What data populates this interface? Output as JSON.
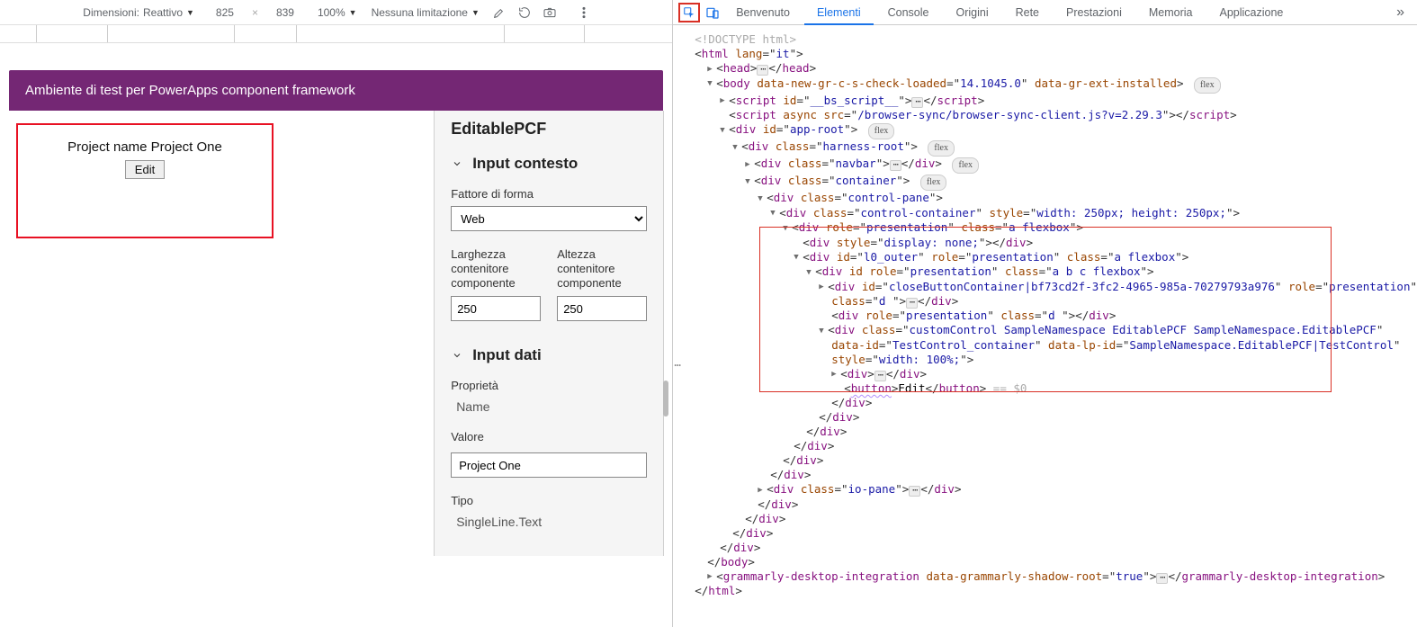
{
  "toolbar": {
    "dimensions_label": "Dimensioni:",
    "dimensions_value": "Reattivo",
    "width": "825",
    "height": "839",
    "zoom": "100%",
    "throttle": "Nessuna limitazione"
  },
  "preview": {
    "header": "Ambiente di test per PowerApps component framework",
    "component_text": "Project name Project One",
    "edit_label": "Edit",
    "side_title": "EditablePCF",
    "section_context": "Input contesto",
    "form_factor_label": "Fattore di forma",
    "form_factor_value": "Web",
    "width_label": "Larghezza contenitore componente",
    "height_label": "Altezza contenitore componente",
    "width_val": "250",
    "height_val": "250",
    "section_data": "Input dati",
    "prop_label": "Proprietà",
    "prop_value": "Name",
    "value_label": "Valore",
    "value_value": "Project One",
    "type_label": "Tipo",
    "type_value": "SingleLine.Text"
  },
  "devtools": {
    "tabs": [
      "Benvenuto",
      "Elementi",
      "Console",
      "Origini",
      "Rete",
      "Prestazioni",
      "Memoria",
      "Applicazione"
    ],
    "active_tab": "Elementi",
    "dom": {
      "doctype": "<!DOCTYPE html>",
      "html_open": "html",
      "html_lang": "it",
      "head": "head",
      "body_open": "body",
      "body_a1": "data-new-gr-c-s-check-loaded",
      "body_v1": "14.1045.0",
      "body_a2": "data-gr-ext-installed",
      "flex": "flex",
      "script_id": "__bs_script__",
      "script_async_src": "/browser-sync/browser-sync-client.js?v=2.29.3",
      "app_root": "app-root",
      "harness_root": "harness-root",
      "navbar": "navbar",
      "container": "container",
      "control_pane": "control-pane",
      "control_container": "control-container",
      "cc_style": "width: 250px; height: 250px;",
      "a_flexbox": "a flexbox",
      "display_none": "display: none;",
      "outer_id": "l0_outer",
      "abc": "a b c flexbox",
      "close_id": "closeButtonContainer|bf73cd2f-3fc2-4965-985a-70279793a976",
      "d": "d ",
      "custom_class": "customControl SampleNamespace EditablePCF SampleNamespace.EditablePCF",
      "data_id": "TestControl_container",
      "data_lp": "SampleNamespace.EditablePCF|TestControl",
      "width100": "width: 100%;",
      "edit": "Edit",
      "zero": "$0",
      "io_pane": "io-pane",
      "grammarly": "grammarly-desktop-integration",
      "grammarly_attr": "data-grammarly-shadow-root",
      "true": "true",
      "presentation": "presentation",
      "button": "button",
      "div": "div",
      "script": "script"
    }
  }
}
